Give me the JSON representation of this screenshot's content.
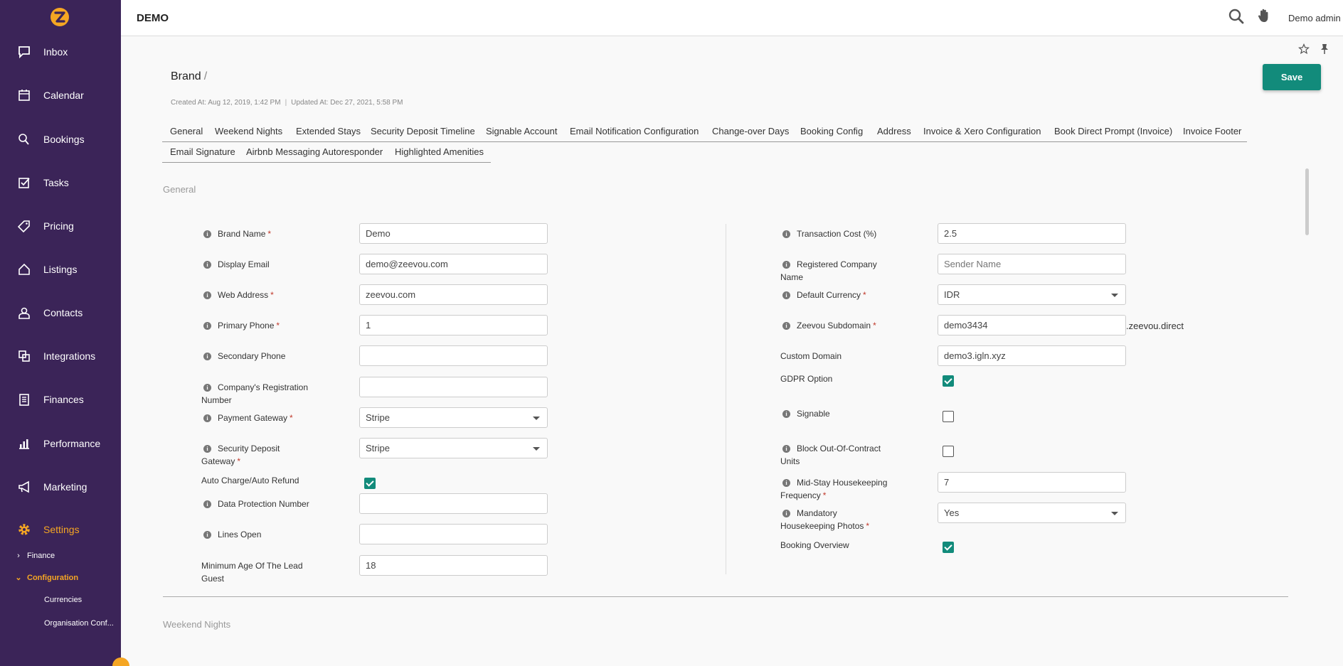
{
  "app": {
    "title": "DEMO",
    "user": "Demo admin"
  },
  "sidebar": {
    "items": [
      {
        "label": "Inbox",
        "icon": "chat-icon"
      },
      {
        "label": "Calendar",
        "icon": "calendar-icon"
      },
      {
        "label": "Bookings",
        "icon": "bookings-icon"
      },
      {
        "label": "Tasks",
        "icon": "tasks-icon"
      },
      {
        "label": "Pricing",
        "icon": "tag-icon"
      },
      {
        "label": "Listings",
        "icon": "home-icon"
      },
      {
        "label": "Contacts",
        "icon": "user-icon"
      },
      {
        "label": "Integrations",
        "icon": "integrations-icon"
      },
      {
        "label": "Finances",
        "icon": "finances-icon"
      },
      {
        "label": "Performance",
        "icon": "chart-icon"
      },
      {
        "label": "Marketing",
        "icon": "megaphone-icon"
      },
      {
        "label": "Settings",
        "icon": "gear-icon"
      }
    ],
    "sub": {
      "finance": "Finance",
      "configuration": "Configuration",
      "currencies": "Currencies",
      "organisation": "Organisation Conf..."
    }
  },
  "header": {
    "breadcrumb": "Brand",
    "breadcrumb_sep": "/",
    "created": "Created At: Aug 12, 2019, 1:42 PM",
    "updated": "Updated At: Dec 27, 2021, 5:58 PM",
    "save_label": "Save"
  },
  "tabs": {
    "row1": [
      "General",
      "Weekend Nights",
      "Extended Stays",
      "Security Deposit Timeline",
      "Signable Account",
      "Email Notification Configuration",
      "Change-over Days",
      "Booking Config",
      "Address",
      "Invoice & Xero Configuration",
      "Book Direct Prompt (Invoice)",
      "Invoice Footer"
    ],
    "row2": [
      "Email Signature",
      "Airbnb Messaging Autoresponder",
      "Highlighted Amenities"
    ]
  },
  "sections": {
    "general": "General",
    "weekend": "Weekend Nights"
  },
  "form": {
    "brand_name": {
      "label": "Brand Name",
      "value": "Demo"
    },
    "display_email": {
      "label": "Display Email",
      "value": "demo@zeevou.com"
    },
    "web_address": {
      "label": "Web Address",
      "value": "zeevou.com"
    },
    "primary_phone": {
      "label": "Primary Phone",
      "value": "1"
    },
    "secondary_phone": {
      "label": "Secondary Phone",
      "value": ""
    },
    "company_reg": {
      "label1": "Company's Registration",
      "label2": "Number",
      "value": ""
    },
    "payment_gateway": {
      "label": "Payment Gateway",
      "value": "Stripe"
    },
    "security_gateway": {
      "label1": "Security Deposit",
      "label2": "Gateway",
      "value": "Stripe"
    },
    "auto_charge": {
      "label": "Auto Charge/Auto Refund"
    },
    "data_protection": {
      "label": "Data Protection Number",
      "value": ""
    },
    "lines_open": {
      "label": "Lines Open",
      "value": ""
    },
    "min_age": {
      "label1": "Minimum Age Of The Lead",
      "label2": "Guest",
      "value": "18"
    },
    "transaction_cost": {
      "label": "Transaction Cost (%)",
      "value": "2.5"
    },
    "registered_company": {
      "label1": "Registered Company",
      "label2": "Name",
      "placeholder": "Sender Name"
    },
    "default_currency": {
      "label": "Default Currency",
      "value": "IDR"
    },
    "subdomain": {
      "label": "Zeevou Subdomain",
      "value": "demo3434",
      "suffix": ".zeevou.direct"
    },
    "custom_domain": {
      "label": "Custom Domain",
      "value": "demo3.igln.xyz"
    },
    "gdpr": {
      "label": "GDPR Option"
    },
    "signable": {
      "label": "Signable"
    },
    "block_units": {
      "label1": "Block Out-Of-Contract",
      "label2": "Units"
    },
    "midstay": {
      "label1": "Mid-Stay Housekeeping",
      "label2": "Frequency",
      "value": "7"
    },
    "mandatory_photos": {
      "label1": "Mandatory",
      "label2": "Housekeeping Photos",
      "value": "Yes"
    },
    "booking_overview": {
      "label": "Booking Overview"
    }
  }
}
